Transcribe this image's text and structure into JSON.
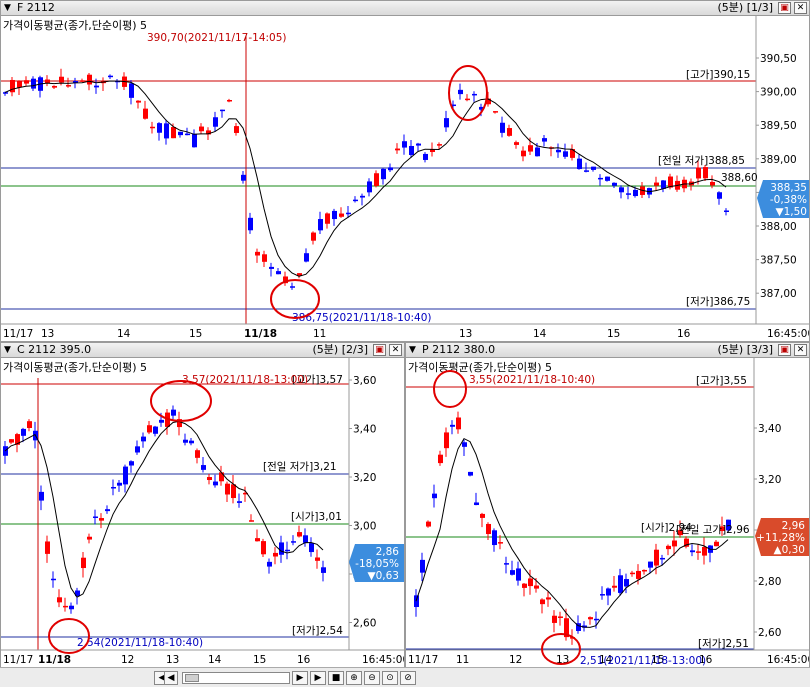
{
  "panels": {
    "f": {
      "title": "F 2112",
      "meta": "(5분) [1/3]",
      "indicator": "가격이동평균(종가,단순이평) 5",
      "price_axis": [
        "390,50",
        "390,00",
        "389,50",
        "389,00",
        "388,50",
        "388,00",
        "387,50",
        "387,00"
      ],
      "date_axis": [
        "11/17",
        "13",
        "14",
        "15",
        "11/18",
        "11",
        "13",
        "14",
        "15",
        "16",
        "16:45:00"
      ],
      "labels": {
        "high": "[고가]390,15",
        "prev_low": "[전일 저가]388,85",
        "open": "388,60",
        "low": "[저가]386,75",
        "max_note": "390,70(2021/11/17-14:05)",
        "min_note": "386,75(2021/11/18-10:40)"
      },
      "current": {
        "price": "388,35",
        "pct": "-0,38%",
        "chg": "▼1,50"
      },
      "colors": {
        "up": "#ff0000",
        "down": "#0000ff",
        "badge": "#3c8dde"
      }
    },
    "c": {
      "title": "C 2112 395.0",
      "meta": "(5분) [2/3]",
      "indicator": "가격이동평균(종가,단순이평) 5",
      "price_axis": [
        "3,60",
        "3,40",
        "3,20",
        "3,00",
        "2,80",
        "2,60"
      ],
      "date_axis": [
        "11/17",
        "11/18",
        "12",
        "13",
        "14",
        "15",
        "16",
        "16:45:00"
      ],
      "labels": {
        "high": "[고가]3,57",
        "prev_low": "[전일 저가]3,21",
        "open": "[시가]3,01",
        "low": "[저가]2,54",
        "max_note": "3,57(2021/11/18-13:00)",
        "min_note": "2,54(2021/11/18-10:40)"
      },
      "current": {
        "price": "2,86",
        "pct": "-18,05%",
        "chg": "▼0,63"
      },
      "colors": {
        "badge": "#3c8dde"
      }
    },
    "p": {
      "title": "P 2112 380.0",
      "meta": "(5분) [3/3]",
      "indicator": "가격이동평균(종가,단순이평) 5",
      "price_axis": [
        "3,40",
        "3,20",
        "3,00",
        "2,80",
        "2,60"
      ],
      "date_axis": [
        "11/17",
        "11",
        "12",
        "13",
        "14",
        "15",
        "16",
        "16:45:00"
      ],
      "labels": {
        "high": "[고가]3,55",
        "prev_high": "[전일 고가]2,96",
        "open": "[시가]2,94",
        "low": "[저가]2,51",
        "max_note": "3,55(2021/11/18-10:40)",
        "min_note": "2,51(2021/11/18-13:00)"
      },
      "current": {
        "price": "2,96",
        "pct": "+11,28%",
        "chg": "▲0,30"
      },
      "colors": {
        "badge": "#d94b2b"
      }
    }
  },
  "scrollbar": {
    "zoom_icons": [
      "zoom-in-icon",
      "zoom-out-icon",
      "zoom-reset-icon",
      "zoom-fit-icon"
    ]
  }
}
